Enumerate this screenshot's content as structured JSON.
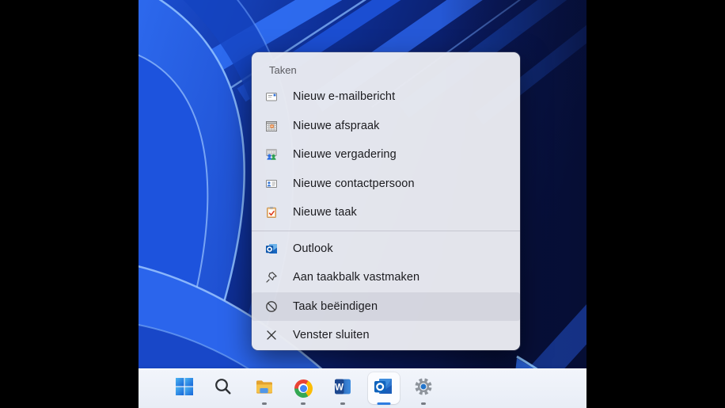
{
  "jumplist": {
    "header": "Taken",
    "tasks": [
      {
        "label": "Nieuw e-mailbericht",
        "icon": "new-email-icon"
      },
      {
        "label": "Nieuwe afspraak",
        "icon": "new-appointment-icon"
      },
      {
        "label": "Nieuwe vergadering",
        "icon": "new-meeting-icon"
      },
      {
        "label": "Nieuwe contactpersoon",
        "icon": "new-contact-icon"
      },
      {
        "label": "Nieuwe taak",
        "icon": "new-task-icon"
      }
    ],
    "app_items": [
      {
        "label": "Outlook",
        "icon": "outlook-icon",
        "highlighted": false
      },
      {
        "label": "Aan taakbalk vastmaken",
        "icon": "pin-icon",
        "highlighted": false
      },
      {
        "label": "Taak beëindigen",
        "icon": "end-task-icon",
        "highlighted": true
      },
      {
        "label": "Venster sluiten",
        "icon": "close-icon",
        "highlighted": false
      }
    ]
  },
  "taskbar": {
    "buttons": [
      {
        "id": "start",
        "icon": "windows-start-icon",
        "running": false,
        "active": false
      },
      {
        "id": "search",
        "icon": "search-icon",
        "running": false,
        "active": false
      },
      {
        "id": "file-explorer",
        "icon": "file-explorer-icon",
        "running": true,
        "active": false
      },
      {
        "id": "chrome",
        "icon": "chrome-icon",
        "running": true,
        "active": false
      },
      {
        "id": "word",
        "icon": "word-icon",
        "running": true,
        "active": false
      },
      {
        "id": "outlook",
        "icon": "outlook-icon",
        "running": true,
        "active": true
      },
      {
        "id": "settings",
        "icon": "settings-gear-icon",
        "running": true,
        "active": false
      }
    ]
  },
  "colors": {
    "accent": "#2d7ce0",
    "menu_background": "#eaebf1",
    "menu_highlight": "#dfe0e6",
    "menu_text": "#1b1b1f",
    "menu_header_text": "#5b5b60",
    "taskbar_background": "#edf1f9",
    "wallpaper_base": "#0a1850"
  }
}
